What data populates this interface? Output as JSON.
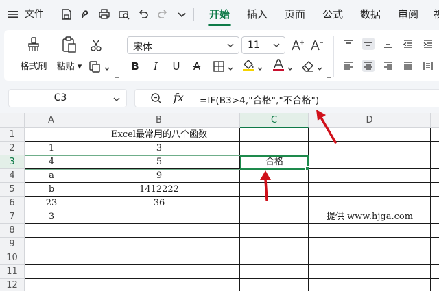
{
  "menubar": {
    "file_label": "文件",
    "tabs": [
      {
        "label": "开始",
        "active": true
      },
      {
        "label": "插入",
        "active": false
      },
      {
        "label": "页面",
        "active": false
      },
      {
        "label": "公式",
        "active": false
      },
      {
        "label": "数据",
        "active": false
      },
      {
        "label": "审阅",
        "active": false
      },
      {
        "label": "视",
        "active": false
      }
    ]
  },
  "ribbon": {
    "format_painter_label": "格式刷",
    "paste_label": "粘贴",
    "font_name": "宋体",
    "font_size": "11",
    "bold_label": "B",
    "italic_label": "I",
    "underline_label": "U",
    "strike_label": "A",
    "font_color": "#c8102e",
    "fill_color": "#f5d300"
  },
  "formula_bar": {
    "cell_ref": "C3",
    "fx_label": "fx",
    "formula": "=IF(B3>4,\"合格\",\"不合格\")"
  },
  "sheet": {
    "columns": [
      "A",
      "B",
      "C",
      "D"
    ],
    "selected_column": "C",
    "rows": [
      "1",
      "2",
      "3",
      "4",
      "5",
      "6",
      "7",
      "8",
      "9",
      "10",
      "11",
      "12"
    ],
    "selected_row": "3",
    "cells": {
      "B1": "Excel最常用的八个函数",
      "A2": "1",
      "B2": "3",
      "A3": "4",
      "B3": "5",
      "C3": "合格",
      "A4": "a",
      "B4": "9",
      "A5": "b",
      "B5": "1412222",
      "A6": "23",
      "B6": "36",
      "A7": "3",
      "D7": "提供 www.hjga.com"
    }
  },
  "accent_color": "#0e7a48",
  "annotation_color": "#d0101a"
}
